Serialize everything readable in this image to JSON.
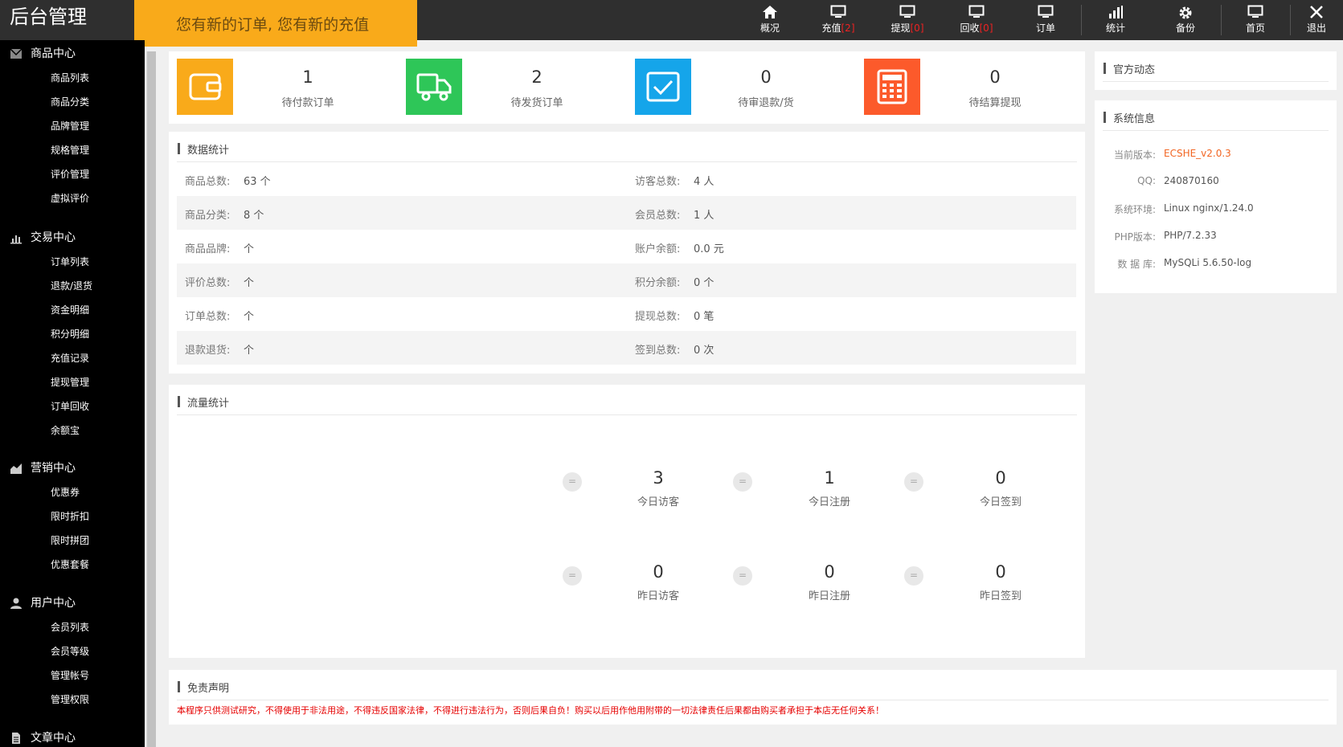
{
  "app": {
    "title": "后台管理"
  },
  "notice": "您有新的订单, 您有新的充值",
  "topnav": [
    {
      "label": "概况",
      "count": "",
      "icon": "home-icon"
    },
    {
      "label": "充值",
      "count": "[2]",
      "icon": "monitor-icon"
    },
    {
      "label": "提现",
      "count": "[0]",
      "icon": "monitor-icon"
    },
    {
      "label": "回收",
      "count": "[0]",
      "icon": "monitor-icon"
    },
    {
      "label": "订单",
      "count": "",
      "icon": "monitor-icon"
    },
    {
      "label": "统计",
      "count": "",
      "icon": "bar-chart-icon"
    },
    {
      "label": "备份",
      "count": "",
      "icon": "gear-icon"
    },
    {
      "label": "首页",
      "count": "",
      "icon": "monitor-icon"
    },
    {
      "label": "退出",
      "count": "",
      "icon": "close-icon"
    }
  ],
  "sidebar": {
    "groups": [
      {
        "label": "商品中心",
        "icon": "mail-icon",
        "items": [
          "商品列表",
          "商品分类",
          "品牌管理",
          "规格管理",
          "评价管理",
          "虚拟评价"
        ]
      },
      {
        "label": "交易中心",
        "icon": "bar-chart-icon",
        "items": [
          "订单列表",
          "退款/退货",
          "资金明细",
          "积分明细",
          "充值记录",
          "提现管理",
          "订单回收",
          "余额宝"
        ]
      },
      {
        "label": "营销中心",
        "icon": "area-chart-icon",
        "items": [
          "优惠券",
          "限时折扣",
          "限时拼团",
          "优惠套餐"
        ]
      },
      {
        "label": "用户中心",
        "icon": "user-icon",
        "items": [
          "会员列表",
          "会员等级",
          "管理帐号",
          "管理权限"
        ]
      },
      {
        "label": "文章中心",
        "icon": "document-icon",
        "items": []
      }
    ]
  },
  "stats": [
    {
      "value": "1",
      "label": "待付款订单",
      "color": "#f9aa1a",
      "icon": "wallet-icon"
    },
    {
      "value": "2",
      "label": "待发货订单",
      "color": "#2ec658",
      "icon": "truck-icon"
    },
    {
      "value": "0",
      "label": "待审退款/货",
      "color": "#15a5ea",
      "icon": "checkbox-icon"
    },
    {
      "value": "0",
      "label": "待结算提现",
      "color": "#fc5a2b",
      "icon": "calculator-icon"
    }
  ],
  "data_stats": {
    "title": "数据统计",
    "rows": [
      {
        "l_label": "商品总数:",
        "l_value": "63 个",
        "r_label": "访客总数:",
        "r_value": "4 人"
      },
      {
        "l_label": "商品分类:",
        "l_value": "8 个",
        "r_label": "会员总数:",
        "r_value": "1 人"
      },
      {
        "l_label": "商品品牌:",
        "l_value": "个",
        "r_label": "账户余额:",
        "r_value": "0.0 元"
      },
      {
        "l_label": "评价总数:",
        "l_value": "个",
        "r_label": "积分余额:",
        "r_value": "0 个"
      },
      {
        "l_label": "订单总数:",
        "l_value": "个",
        "r_label": "提现总数:",
        "r_value": "0 笔"
      },
      {
        "l_label": "退款退货:",
        "l_value": "个",
        "r_label": "签到总数:",
        "r_value": "0 次"
      }
    ]
  },
  "traffic": {
    "title": "流量统计",
    "eq": "=",
    "items": [
      {
        "value": "3",
        "label": "今日访客"
      },
      {
        "value": "1",
        "label": "今日注册"
      },
      {
        "value": "0",
        "label": "今日签到"
      },
      {
        "value": "0",
        "label": "昨日访客"
      },
      {
        "value": "0",
        "label": "昨日注册"
      },
      {
        "value": "0",
        "label": "昨日签到"
      }
    ]
  },
  "official": {
    "title": "官方动态"
  },
  "sysinfo": {
    "title": "系统信息",
    "rows": [
      {
        "label": "当前版本:",
        "value": "ECSHE_v2.0.3",
        "highlight": true
      },
      {
        "label": "QQ:",
        "value": "240870160"
      },
      {
        "label": "系统环境:",
        "value": "Linux nginx/1.24.0"
      },
      {
        "label": "PHP版本:",
        "value": "PHP/7.2.33"
      },
      {
        "label": "数 据 库:",
        "value": "MySQLi 5.6.50-log"
      }
    ]
  },
  "disclaimer": {
    "title": "免责声明",
    "text": "本程序只供测试研究，不得使用于非法用途，不得违反国家法律，不得进行违法行为，否则后果自负！购买以后用作他用附带的一切法律责任后果都由购买者承担于本店无任何关系！"
  },
  "colors": {
    "topbar": "#2f2f2f",
    "accent": "#f9aa1a",
    "version": "#f26522",
    "disclaimer": "#e60000"
  }
}
